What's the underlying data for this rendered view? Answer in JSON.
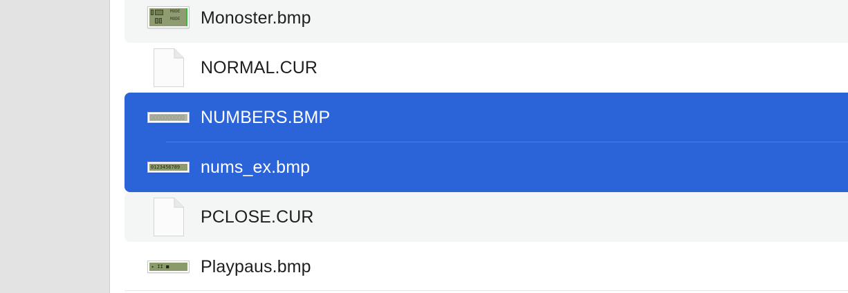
{
  "files": [
    {
      "name": "Monoster.bmp",
      "kind": "bmp-thumbnail",
      "thumbnail": "monoster-thumbnail",
      "selected": false,
      "striped": true
    },
    {
      "name": "NORMAL.CUR",
      "kind": "generic-document",
      "selected": false,
      "striped": false
    },
    {
      "name": "NUMBERS.BMP",
      "kind": "bmp-thumbnail",
      "thumbnail": "numbers-strip-thumbnail",
      "selected": true,
      "striped": false
    },
    {
      "name": "nums_ex.bmp",
      "kind": "bmp-thumbnail",
      "thumbnail": "nums-ex-strip-thumbnail",
      "selected": true,
      "striped": false
    },
    {
      "name": "PCLOSE.CUR",
      "kind": "generic-document",
      "selected": false,
      "striped": true
    },
    {
      "name": "Playpaus.bmp",
      "kind": "bmp-thumbnail",
      "thumbnail": "playpaus-thumbnail",
      "selected": false,
      "striped": false
    }
  ],
  "thumb_text": {
    "monoster_top": "MODE",
    "monoster_bottom": "MODE",
    "nums_digits": "0123456789",
    "playpaus_glyphs": "▸ II ■"
  },
  "colors": {
    "selection": "#2b63d9",
    "stripe": "#f4f5f5",
    "sidebar": "#e3e3e3",
    "text": "#1f1f1f",
    "selected_text": "#ffffff"
  }
}
